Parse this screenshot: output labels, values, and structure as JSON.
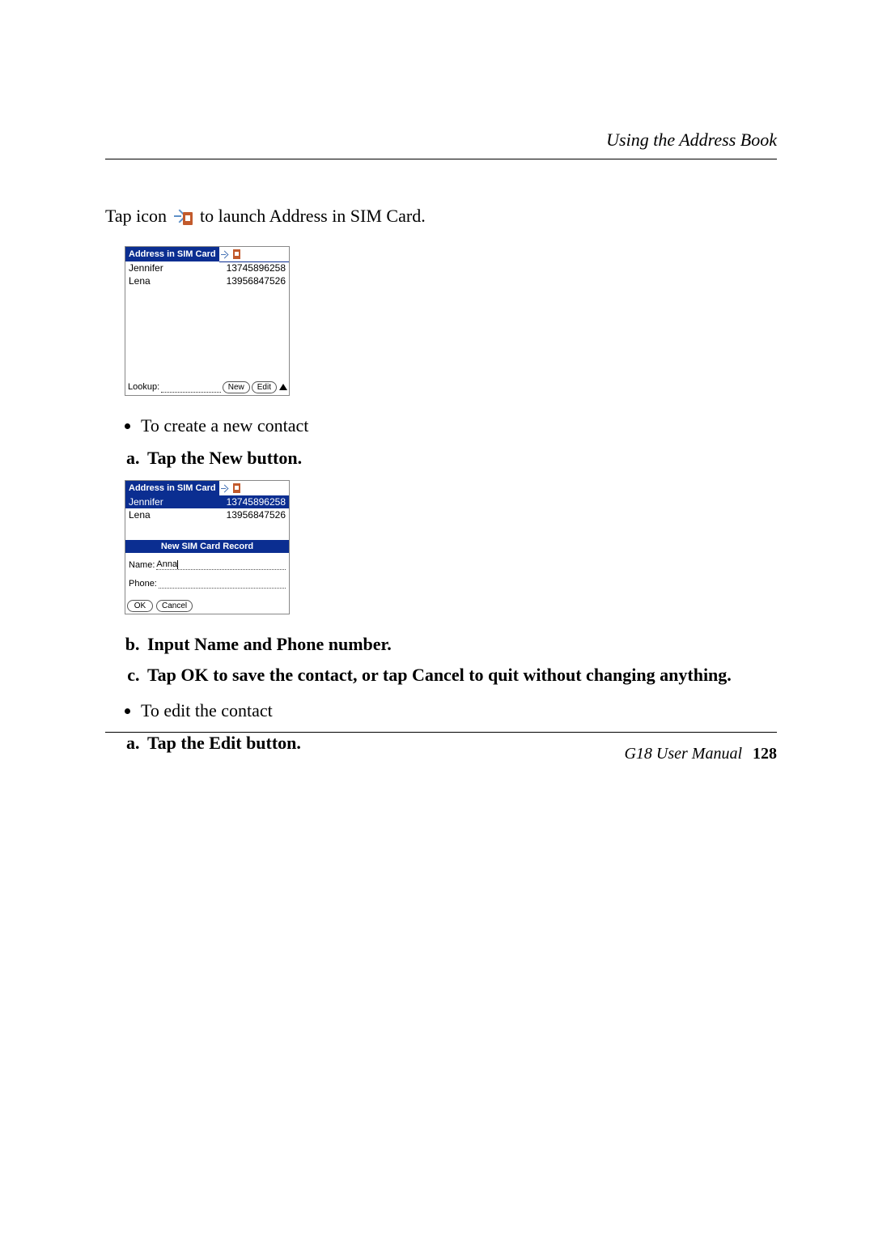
{
  "header": {
    "section": "Using the Address Book"
  },
  "intro": {
    "before_icon": "Tap icon ",
    "after_icon": " to launch Address in SIM Card."
  },
  "screenshot1": {
    "title": "Address in SIM Card",
    "rows": [
      {
        "name": "Jennifer",
        "phone": "13745896258"
      },
      {
        "name": "Lena",
        "phone": "13956847526"
      }
    ],
    "lookup_label": "Lookup:",
    "new_btn": "New",
    "edit_btn": "Edit"
  },
  "bullet1": "To create a new contact",
  "step_a1": "Tap the New button.",
  "screenshot2": {
    "title": "Address in SIM Card",
    "rows": [
      {
        "name": "Jennifer",
        "phone": "13745896258",
        "selected": true
      },
      {
        "name": "Lena",
        "phone": "13956847526",
        "selected": false
      }
    ],
    "dialog_title": "New SIM Card Record",
    "name_label": "Name:",
    "name_value": "Anna",
    "phone_label": "Phone:",
    "ok_btn": "OK",
    "cancel_btn": "Cancel"
  },
  "step_b": "Input Name and Phone number.",
  "step_c": "Tap OK to save the contact, or tap Cancel to quit without changing anything.",
  "bullet2": "To edit the contact",
  "step_a2": "Tap the Edit button.",
  "footer": {
    "manual": "G18 User Manual",
    "page": "128"
  }
}
